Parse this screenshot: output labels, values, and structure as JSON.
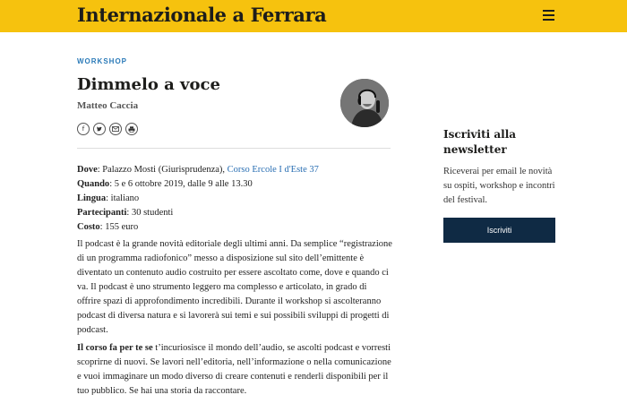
{
  "header": {
    "brand": "Internazionale a Ferrara",
    "menu_icon": "hamburger-menu-icon",
    "background_color": "#f6c20e"
  },
  "article": {
    "category": "WORKSHOP",
    "title": "Dimmelo a voce",
    "author": "Matteo Caccia",
    "share_icons": [
      "facebook-icon",
      "twitter-icon",
      "email-icon",
      "print-icon"
    ],
    "details": {
      "dove_label": "Dove",
      "dove_value": ": Palazzo Mosti (Giurisprudenza), ",
      "dove_link": "Corso Ercole I d'Este 37",
      "quando_label": "Quando",
      "quando_value": ": 5 e 6 ottobre 2019, dalle 9 alle 13.30",
      "lingua_label": "Lingua",
      "lingua_value": ": italiano",
      "partecipanti_label": "Partecipanti",
      "partecipanti_value": ": 30 studenti",
      "costo_label": "Costo",
      "costo_value": ": 155 euro"
    },
    "paragraph1": "Il podcast è la grande novità editoriale degli ultimi anni. Da semplice “registrazione di un programma radiofonico” messo a disposizione sul sito dell’emittente è diventato un contenuto audio costruito per essere ascoltato come, dove e quando ci va. Il podcast è uno strumento leggero ma complesso e articolato, in grado di offrire spazi di approfondimento incredibili. Durante il workshop si ascolteranno podcast di diversa natura e si lavorerà sui temi e sui possibili sviluppi di progetti di podcast.",
    "paragraph2_bold": "Il corso fa per te se",
    "paragraph2_rest": " t’incuriosisce il mondo dell’audio, se ascolti podcast e vorresti scoprirne di nuovi. Se lavori nell’editoria, nell’informazione o nella comunicazione e vuoi immaginare un modo diverso di creare contenuti e renderli disponibili per il tuo pubblico. Se hai una storia da raccontare."
  },
  "newsletter": {
    "title": "Iscriviti alla newsletter",
    "text": "Riceverai per email le novità su ospiti, workshop e incontri del festival.",
    "button_label": "Iscriviti",
    "button_color": "#0f2a44"
  },
  "colors": {
    "accent_link": "#2a6fb3",
    "category": "#2a7ab8"
  }
}
